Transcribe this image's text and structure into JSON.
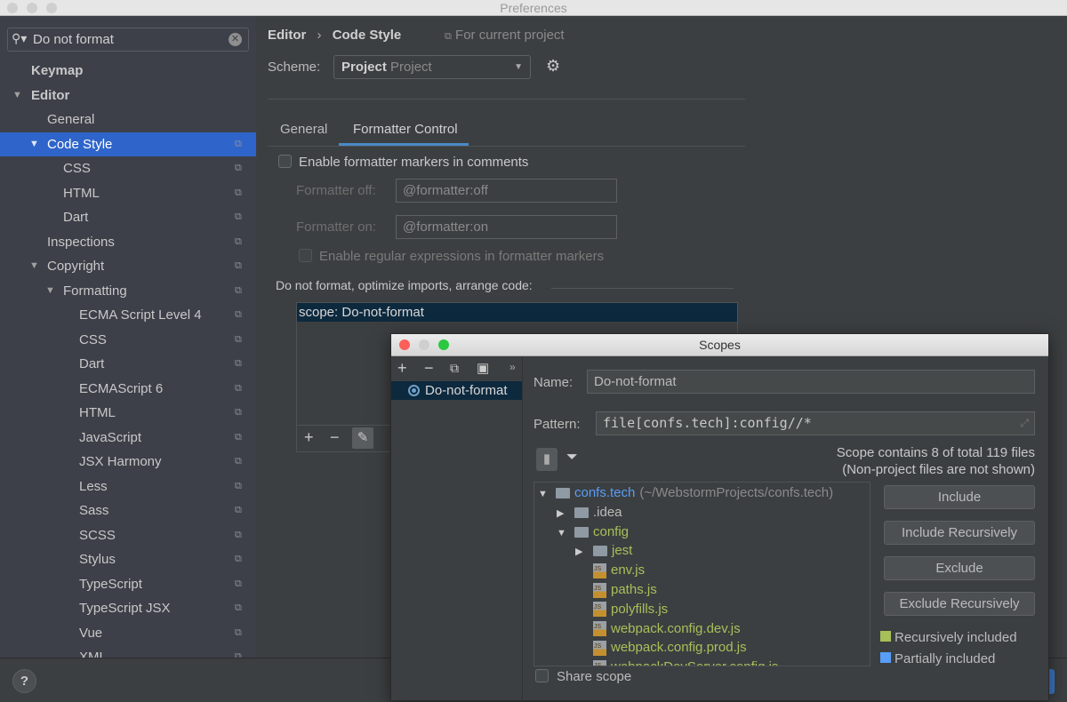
{
  "window": {
    "title": "Preferences"
  },
  "search": {
    "value": "Do not format"
  },
  "sidebar": {
    "items": [
      {
        "label": "Keymap",
        "bold": true
      },
      {
        "label": "Editor",
        "bold": true,
        "expanded": true
      },
      {
        "label": "General"
      },
      {
        "label": "Code Style",
        "expanded": true,
        "selected": true
      },
      {
        "label": "CSS"
      },
      {
        "label": "HTML"
      },
      {
        "label": "Dart"
      },
      {
        "label": "Inspections"
      },
      {
        "label": "Copyright",
        "expanded": true
      },
      {
        "label": "Formatting",
        "expanded": true
      },
      {
        "label": "ECMA Script Level 4"
      },
      {
        "label": "CSS"
      },
      {
        "label": "Dart"
      },
      {
        "label": "ECMAScript 6"
      },
      {
        "label": "HTML"
      },
      {
        "label": "JavaScript"
      },
      {
        "label": "JSX Harmony"
      },
      {
        "label": "Less"
      },
      {
        "label": "Sass"
      },
      {
        "label": "SCSS"
      },
      {
        "label": "Stylus"
      },
      {
        "label": "TypeScript"
      },
      {
        "label": "TypeScript JSX"
      },
      {
        "label": "Vue"
      },
      {
        "label": "XML"
      }
    ]
  },
  "breadcrumb": {
    "parent": "Editor",
    "separator": "›",
    "current": "Code Style",
    "project_note": "For current project"
  },
  "scheme": {
    "label": "Scheme:",
    "value_bold": "Project",
    "value": "Project"
  },
  "tabs": [
    {
      "label": "General"
    },
    {
      "label": "Formatter Control",
      "active": true
    }
  ],
  "formatter": {
    "enable_markers": "Enable formatter markers in comments",
    "off_label": "Formatter off:",
    "off_value": "@formatter:off",
    "on_label": "Formatter on:",
    "on_value": "@formatter:on",
    "regex": "Enable regular expressions in formatter markers",
    "do_not_format_label": "Do not format, optimize imports, arrange code:",
    "scopes": [
      "scope: Do-not-format"
    ]
  },
  "scopes_dialog": {
    "title": "Scopes",
    "list": [
      "Do-not-format"
    ],
    "name_label": "Name:",
    "name_value": "Do-not-format",
    "pattern_label": "Pattern:",
    "pattern_value": "file[confs.tech]:config//*",
    "info1": "Scope contains 8 of total 119 files",
    "info2": "(Non-project files are not shown)",
    "tree": [
      {
        "label": "confs.tech",
        "extra": "(~/WebstormProjects/confs.tech)",
        "type": "folder",
        "level": 0,
        "arrow": "down",
        "color": "#589df6"
      },
      {
        "label": ".idea",
        "type": "folder",
        "level": 1,
        "arrow": "right",
        "color": "#bbbbbb"
      },
      {
        "label": "config",
        "type": "folder",
        "level": 1,
        "arrow": "down",
        "color": "#a7c05a"
      },
      {
        "label": "jest",
        "type": "folder",
        "level": 2,
        "arrow": "right",
        "color": "#a7c05a"
      },
      {
        "label": "env.js",
        "type": "js",
        "level": 2,
        "color": "#a7c05a"
      },
      {
        "label": "paths.js",
        "type": "js",
        "level": 2,
        "color": "#a7c05a"
      },
      {
        "label": "polyfills.js",
        "type": "js",
        "level": 2,
        "color": "#a7c05a"
      },
      {
        "label": "webpack.config.dev.js",
        "type": "js",
        "level": 2,
        "color": "#a7c05a"
      },
      {
        "label": "webpack.config.prod.js",
        "type": "js",
        "level": 2,
        "color": "#a7c05a"
      },
      {
        "label": "webpackDevServer.config.js",
        "type": "js",
        "level": 2,
        "color": "#a7c05a"
      }
    ],
    "buttons": [
      "Include",
      "Include Recursively",
      "Exclude",
      "Exclude Recursively"
    ],
    "legend": [
      {
        "label": "Recursively included",
        "color": "#a7c05a"
      },
      {
        "label": "Partially included",
        "color": "#589df6"
      }
    ],
    "share_scope": "Share scope"
  },
  "help": {
    "label": "?"
  }
}
